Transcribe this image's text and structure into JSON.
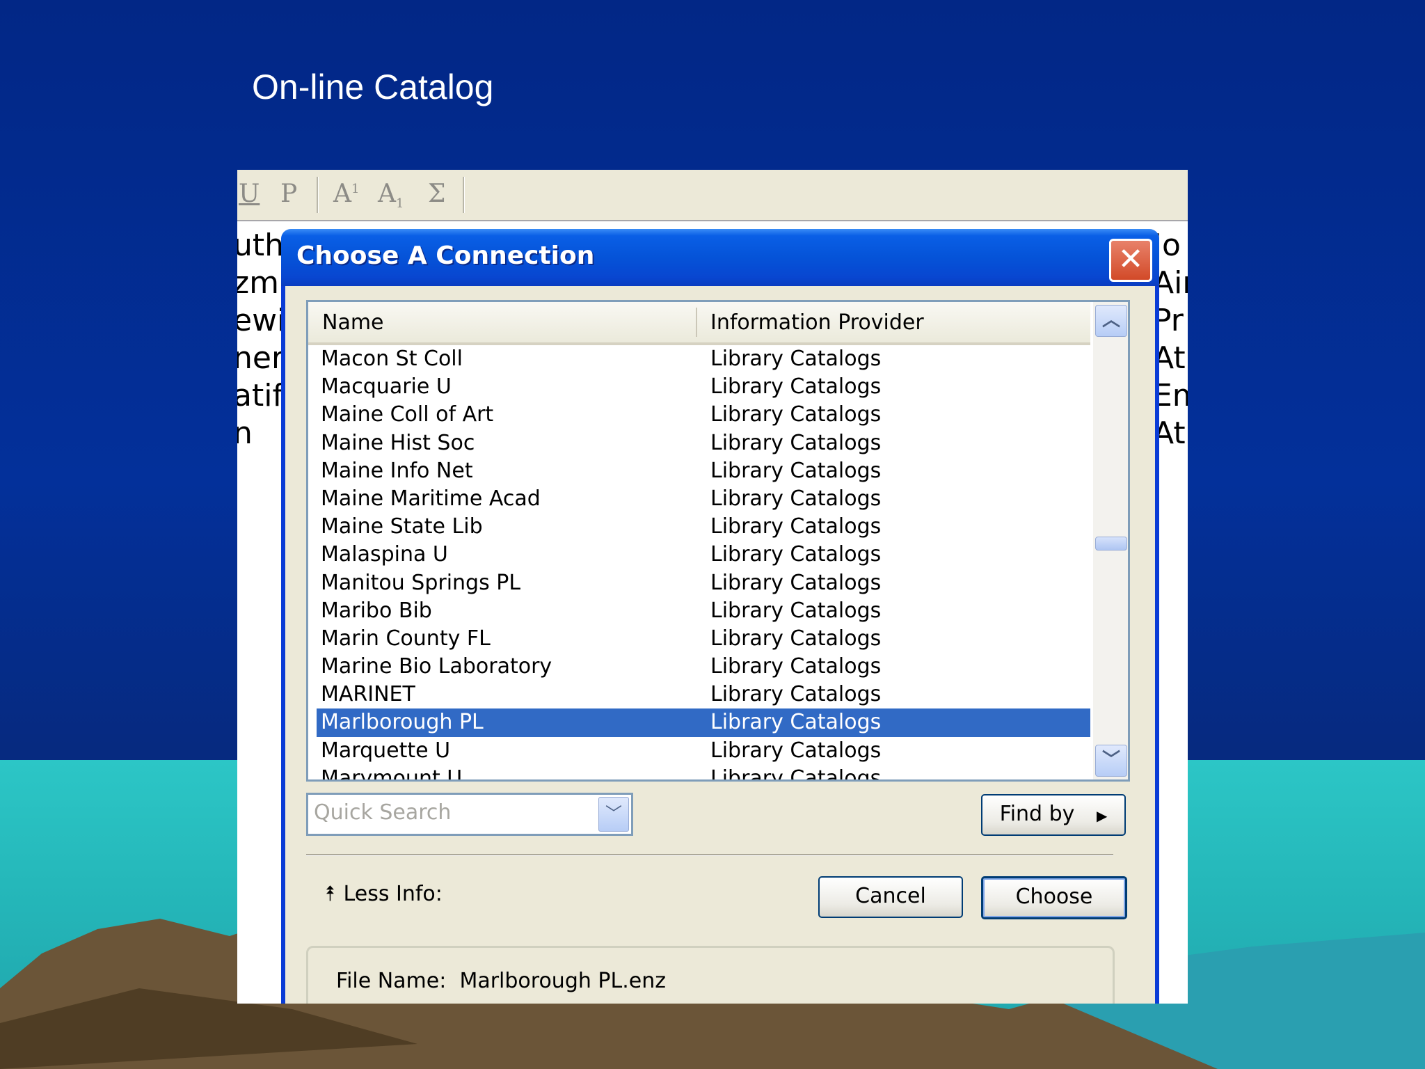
{
  "slide": {
    "title": "On-line Catalog"
  },
  "toolbar": {
    "underline_label": "U",
    "plain_label": "P",
    "superscript_label": "A",
    "superscript_mark": "1",
    "subscript_label": "A",
    "subscript_mark": "1",
    "symbol_label": "Σ"
  },
  "background_text": {
    "left_fragments": [
      "uth",
      "zmi",
      "ewi",
      "ner",
      "atif",
      "n"
    ],
    "right_fragments": [
      "Jo",
      "Air",
      "Pr",
      "Atr",
      "Em",
      "Atr"
    ]
  },
  "dialog": {
    "title": "Choose A Connection",
    "close_label": "✕",
    "columns": [
      "Name",
      "Information Provider"
    ],
    "rows": [
      {
        "name": "Macon St Coll",
        "provider": "Library Catalogs"
      },
      {
        "name": "Macquarie U",
        "provider": "Library Catalogs"
      },
      {
        "name": "Maine Coll of Art",
        "provider": "Library Catalogs"
      },
      {
        "name": "Maine Hist Soc",
        "provider": "Library Catalogs"
      },
      {
        "name": "Maine Info Net",
        "provider": "Library Catalogs"
      },
      {
        "name": "Maine Maritime Acad",
        "provider": "Library Catalogs"
      },
      {
        "name": "Maine State Lib",
        "provider": "Library Catalogs"
      },
      {
        "name": "Malaspina U",
        "provider": "Library Catalogs"
      },
      {
        "name": "Manitou Springs PL",
        "provider": "Library Catalogs"
      },
      {
        "name": "Maribo Bib",
        "provider": "Library Catalogs"
      },
      {
        "name": "Marin County FL",
        "provider": "Library Catalogs"
      },
      {
        "name": "Marine Bio Laboratory",
        "provider": "Library Catalogs"
      },
      {
        "name": "MARINET",
        "provider": "Library Catalogs"
      },
      {
        "name": "Marlborough PL",
        "provider": "Library Catalogs",
        "selected": true
      },
      {
        "name": "Marquette U",
        "provider": "Library Catalogs"
      },
      {
        "name": "Marymount U",
        "provider": "Library Catalogs"
      }
    ],
    "quick_search": {
      "placeholder": "Quick Search"
    },
    "find_by_label": "Find by",
    "less_info_label": "Less Info:",
    "cancel_label": "Cancel",
    "choose_label": "Choose",
    "file_name_label": "File Name:",
    "file_name_value": "Marlborough PL.enz"
  },
  "colors": {
    "slide_bg": "#03309a",
    "title_bar": "#0553d8",
    "selection": "#316ac5",
    "dialog_bg": "#ece9d8",
    "close_button": "#d24a28"
  },
  "icons": [
    "close-icon",
    "scroll-up-icon",
    "scroll-down-icon",
    "dropdown-arrow-icon",
    "right-arrow-icon",
    "collapse-up-icon"
  ]
}
